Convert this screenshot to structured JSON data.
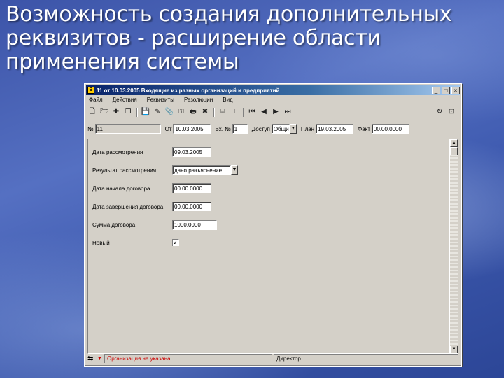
{
  "slide": {
    "title_lines": [
      "Возможность создания дополнительных",
      "реквизитов - расширение области",
      "применения системы"
    ]
  },
  "window": {
    "title": "11 от 10.03.2005 Входящие из разных организаций и предприятий",
    "app_icon_letter": "В",
    "controls": {
      "minimize": "_",
      "maximize": "□",
      "close": "×"
    }
  },
  "menu": [
    "Файл",
    "Действия",
    "Реквизиты",
    "Резолюции",
    "Вид"
  ],
  "toolbar": {
    "icons": [
      "new-doc-icon",
      "open-icon",
      "add-icon",
      "copy-icon",
      "save-icon",
      "edit-icon",
      "attach-icon",
      "key-icon",
      "print-icon",
      "delete-icon",
      "scan-icon",
      "route-icon",
      "first-icon",
      "prev-icon",
      "next-icon",
      "last-icon"
    ],
    "glyphs": [
      "🗋",
      "🗁",
      "✚",
      "❐",
      "💾",
      "✎",
      "📎",
      "⚿",
      "🖶",
      "✖",
      "⌸",
      "⊥",
      "⏮",
      "◀",
      "▶",
      "⏭"
    ],
    "refresh_glyph": "↻",
    "pin_glyph": "⊡"
  },
  "header": {
    "number_label": "№",
    "number_value": "11",
    "from_label": "От",
    "from_value": "10.03.2005",
    "in_no_label": "Вх. №",
    "in_no_value": "1",
    "access_label": "Доступ",
    "access_value": "Общий",
    "plan_label": "План",
    "plan_value": "19.03.2005",
    "fact_label": "Факт",
    "fact_value": "00.00.0000"
  },
  "fields": [
    {
      "label": "Дата рассмотрения",
      "value": "09.03.2005",
      "type": "text"
    },
    {
      "label": "Результат рассмотрения",
      "value": "дано разъяснение",
      "type": "select"
    },
    {
      "label": "Дата начала договора",
      "value": "00.00.0000",
      "type": "text"
    },
    {
      "label": "Дата завершения договора",
      "value": "00.00.0000",
      "type": "text"
    },
    {
      "label": "Сумма договора",
      "value": "1000.0000",
      "type": "text"
    },
    {
      "label": "Новый",
      "value": "✓",
      "type": "checkbox"
    }
  ],
  "status": {
    "icon": "⇆",
    "left": "Организация не указана",
    "right": "Директор",
    "left_color": "#cc0000"
  }
}
